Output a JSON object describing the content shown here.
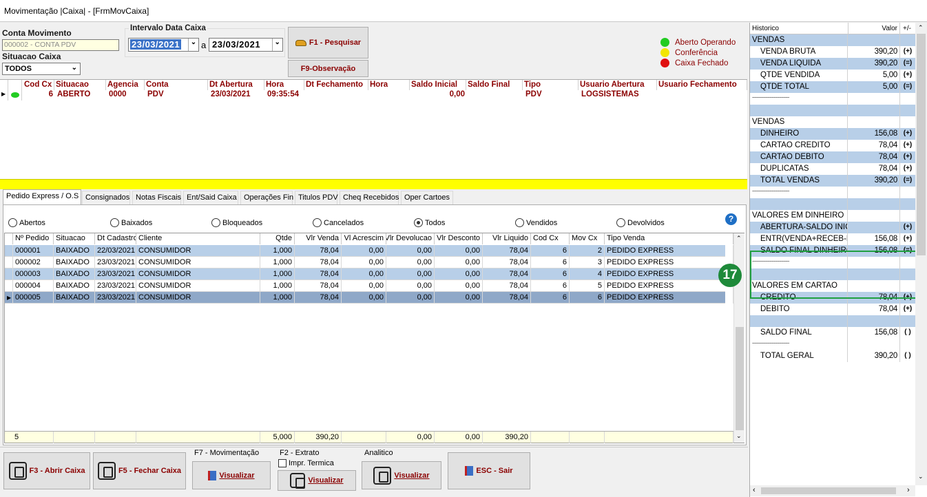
{
  "window": {
    "title": "Movimentação |Caixa| - [FrmMovCaixa]"
  },
  "filters": {
    "conta_label": "Conta Movimento",
    "conta_value": "000002 - CONTA PDV",
    "situacao_label": "Situacao Caixa",
    "situacao_value": "TODOS",
    "intervalo_label": "Intervalo Data Caixa",
    "date_from": "23/03/2021",
    "date_sep": "a",
    "date_to": "23/03/2021",
    "pesquisar_label": "F1 - Pesquisar",
    "observacao_label": "F9-Observação"
  },
  "legend": [
    {
      "label": "Aberto Operando",
      "color": "#22cc22"
    },
    {
      "label": "Conferência",
      "color": "#f2e600"
    },
    {
      "label": "Caixa Fechado",
      "color": "#e01010"
    }
  ],
  "caixa_grid": {
    "headers": [
      "Cod Cx",
      "Situacao",
      "Agencia",
      "Conta",
      "Dt Abertura",
      "Hora",
      "Dt Fechamento",
      "Hora",
      "Saldo Inicial",
      "Saldo Final",
      "Tipo",
      "Usuario Abertura",
      "Usuario Fechamento"
    ],
    "row": [
      "6",
      "ABERTO",
      "0000",
      "PDV",
      "23/03/2021",
      "09:35:54",
      "",
      "",
      "0,00",
      "",
      "PDV",
      "LOGSISTEMAS",
      ""
    ]
  },
  "tabs": [
    "Pedido Express / O.S",
    "Consignados",
    "Notas Fiscais",
    "Ent/Said Caixa",
    "Operações Fin",
    "Titulos PDV",
    "Cheq Recebidos",
    "Oper Cartoes"
  ],
  "radios": [
    {
      "label": "Abertos",
      "checked": false
    },
    {
      "label": "Baixados",
      "checked": false
    },
    {
      "label": "Bloqueados",
      "checked": false
    },
    {
      "label": "Cancelados",
      "checked": false
    },
    {
      "label": "Todos",
      "checked": true
    },
    {
      "label": "Vendidos",
      "checked": false
    },
    {
      "label": "Devolvidos",
      "checked": false
    }
  ],
  "help_icon": "question-circle-icon",
  "orders_grid": {
    "headers": [
      "Nº Pedido",
      "Situacao",
      "Dt Cadastro",
      "Cliente",
      "Qtde",
      "Vlr Venda",
      "Vl Acrescim",
      "Vlr Devolucao",
      "Vlr Desconto",
      "Vlr Liquido",
      "Cod Cx",
      "Mov Cx",
      "Tipo Venda"
    ],
    "rows": [
      [
        "000001",
        "BAIXADO",
        "22/03/2021",
        "CONSUMIDOR",
        "1,000",
        "78,04",
        "0,00",
        "0,00",
        "0,00",
        "78,04",
        "6",
        "2",
        "PEDIDO EXPRESS"
      ],
      [
        "000002",
        "BAIXADO",
        "23/03/2021",
        "CONSUMIDOR",
        "1,000",
        "78,04",
        "0,00",
        "0,00",
        "0,00",
        "78,04",
        "6",
        "3",
        "PEDIDO EXPRESS"
      ],
      [
        "000003",
        "BAIXADO",
        "23/03/2021",
        "CONSUMIDOR",
        "1,000",
        "78,04",
        "0,00",
        "0,00",
        "0,00",
        "78,04",
        "6",
        "4",
        "PEDIDO EXPRESS"
      ],
      [
        "000004",
        "BAIXADO",
        "23/03/2021",
        "CONSUMIDOR",
        "1,000",
        "78,04",
        "0,00",
        "0,00",
        "0,00",
        "78,04",
        "6",
        "5",
        "PEDIDO EXPRESS"
      ],
      [
        "000005",
        "BAIXADO",
        "23/03/2021",
        "CONSUMIDOR",
        "1,000",
        "78,04",
        "0,00",
        "0,00",
        "0,00",
        "78,04",
        "6",
        "6",
        "PEDIDO EXPRESS"
      ]
    ],
    "footer": [
      "5",
      "",
      "",
      "",
      "5,000",
      "390,20",
      "",
      "0,00",
      "0,00",
      "390,20",
      "",
      "",
      ""
    ]
  },
  "bottom": {
    "abrir": "F3 - Abrir Caixa",
    "fechar": "F5 - Fechar Caixa",
    "f7_group": "F7 - Movimentação",
    "f7_btn": "Visualizar",
    "f2_group": "F2 - Extrato",
    "impr_termica": "Impr. Termica",
    "f2_btn": "Visualizar",
    "analitico_group": "Analitico",
    "analitico_btn": "Visualizar",
    "sair": "ESC - Sair"
  },
  "summary": {
    "headers": [
      "Historico",
      "Valor",
      "+/-"
    ],
    "badge": "17",
    "rows": [
      {
        "n": "VENDAS",
        "v": "",
        "s": "",
        "blue": true,
        "indent": false
      },
      {
        "n": "VENDA BRUTA",
        "v": "390,20",
        "s": "(+)",
        "blue": false,
        "indent": true
      },
      {
        "n": "VENDA LIQUIDA",
        "v": "390,20",
        "s": "(=)",
        "blue": true,
        "indent": true
      },
      {
        "n": "QTDE VENDIDA",
        "v": "5,00",
        "s": "(+)",
        "blue": false,
        "indent": true
      },
      {
        "n": "QTDE TOTAL",
        "v": "5,00",
        "s": "(=)",
        "blue": true,
        "indent": true
      },
      {
        "n": "------------------------------------",
        "v": "",
        "s": "",
        "blue": false,
        "indent": false
      },
      {
        "n": "",
        "v": "",
        "s": "",
        "blue": true,
        "indent": false
      },
      {
        "n": "VENDAS",
        "v": "",
        "s": "",
        "blue": false,
        "indent": false
      },
      {
        "n": "DINHEIRO",
        "v": "156,08",
        "s": "(+)",
        "blue": true,
        "indent": true
      },
      {
        "n": "CARTAO CREDITO",
        "v": "78,04",
        "s": "(+)",
        "blue": false,
        "indent": true
      },
      {
        "n": "CARTAO DEBITO",
        "v": "78,04",
        "s": "(+)",
        "blue": true,
        "indent": true
      },
      {
        "n": "DUPLICATAS",
        "v": "78,04",
        "s": "(+)",
        "blue": false,
        "indent": true
      },
      {
        "n": "TOTAL VENDAS",
        "v": "390,20",
        "s": "(=)",
        "blue": true,
        "indent": true
      },
      {
        "n": "------------------------------------",
        "v": "",
        "s": "",
        "blue": false,
        "indent": false
      },
      {
        "n": "",
        "v": "",
        "s": "",
        "blue": true,
        "indent": false
      },
      {
        "n": "VALORES EM DINHEIRO",
        "v": "",
        "s": "",
        "blue": false,
        "indent": false
      },
      {
        "n": "ABERTURA-SALDO INICIAL",
        "v": "",
        "s": "(+)",
        "blue": true,
        "indent": true
      },
      {
        "n": "ENTR(VENDA+RECEB-PGTO)",
        "v": "156,08",
        "s": "(+)",
        "blue": false,
        "indent": true
      },
      {
        "n": "SALDO FINAL DINHEIRO",
        "v": "156,08",
        "s": "(=)",
        "blue": true,
        "indent": true
      },
      {
        "n": "------------------------------------",
        "v": "",
        "s": "",
        "blue": false,
        "indent": false
      },
      {
        "n": "",
        "v": "",
        "s": "",
        "blue": true,
        "indent": false
      },
      {
        "n": "VALORES EM CARTAO",
        "v": "",
        "s": "",
        "blue": false,
        "indent": false
      },
      {
        "n": "CREDITO",
        "v": "78,04",
        "s": "(+)",
        "blue": true,
        "indent": true
      },
      {
        "n": "DEBITO",
        "v": "78,04",
        "s": "(+)",
        "blue": false,
        "indent": true
      },
      {
        "n": "",
        "v": "",
        "s": "",
        "blue": true,
        "indent": false
      },
      {
        "n": "SALDO FINAL",
        "v": "156,08",
        "s": "( )",
        "blue": false,
        "indent": true
      },
      {
        "n": "------------------------------------",
        "v": "",
        "s": "",
        "blue": false,
        "indent": false
      },
      {
        "n": "TOTAL GERAL",
        "v": "390,20",
        "s": "( )",
        "blue": false,
        "indent": true
      }
    ]
  }
}
